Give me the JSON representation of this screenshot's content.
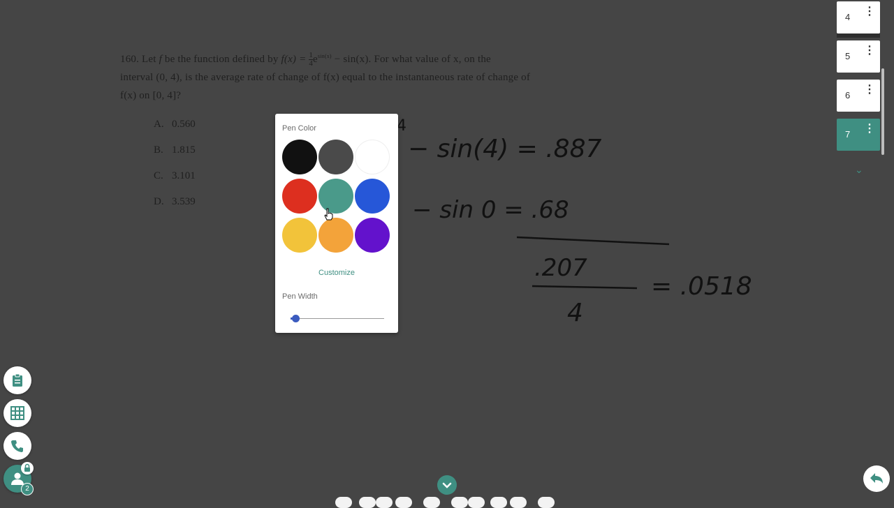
{
  "problem": {
    "number": "160.",
    "line1_a": "Let",
    "line1_f": "f",
    "line1_b": "be the function defined by",
    "line1_fx": "f(x) =",
    "line1_frac_num": "1",
    "line1_frac_den": "4",
    "line1_e": "e",
    "line1_sup": "sin(x)",
    "line1_c": "− sin(x). For what value of x, on the",
    "line2": "interval (0, 4), is the average rate of change of f(x) equal to the instantaneous rate of change of",
    "line3": "f(x) on [0, 4]?"
  },
  "answers": [
    {
      "letter": "A.",
      "value": "0.560"
    },
    {
      "letter": "B.",
      "value": "1.815"
    },
    {
      "letter": "C.",
      "value": "3.101"
    },
    {
      "letter": "D.",
      "value": "3.539"
    }
  ],
  "pen_popup": {
    "title": "Pen Color",
    "colors": [
      "#111111",
      "#4a4a4a",
      "#ffffff",
      "#dd2f1f",
      "#4a9a8a",
      "#2657d8",
      "#f2c33a",
      "#f3a33a",
      "#6312cc"
    ],
    "selected_color": "#4a9a8a",
    "customize_label": "Customize",
    "width_title": "Pen Width",
    "width_level": 0.02
  },
  "pages": [
    {
      "num": "4",
      "active": false
    },
    {
      "num": "5",
      "active": false
    },
    {
      "num": "6",
      "active": false
    },
    {
      "num": "7",
      "active": true
    }
  ],
  "toolbar": {
    "icons": [
      "clipboard-icon",
      "grid-icon",
      "phone-icon",
      "user-icon"
    ],
    "user_badge": "2"
  },
  "handwriting": {
    "line1": "− sin(4) = .887",
    "line2": "− sin 0 = .68",
    "numerator": ".207",
    "denominator": "4",
    "result": "= .0518"
  },
  "colors": {
    "accent": "#3f8f82",
    "background": "#454545"
  }
}
